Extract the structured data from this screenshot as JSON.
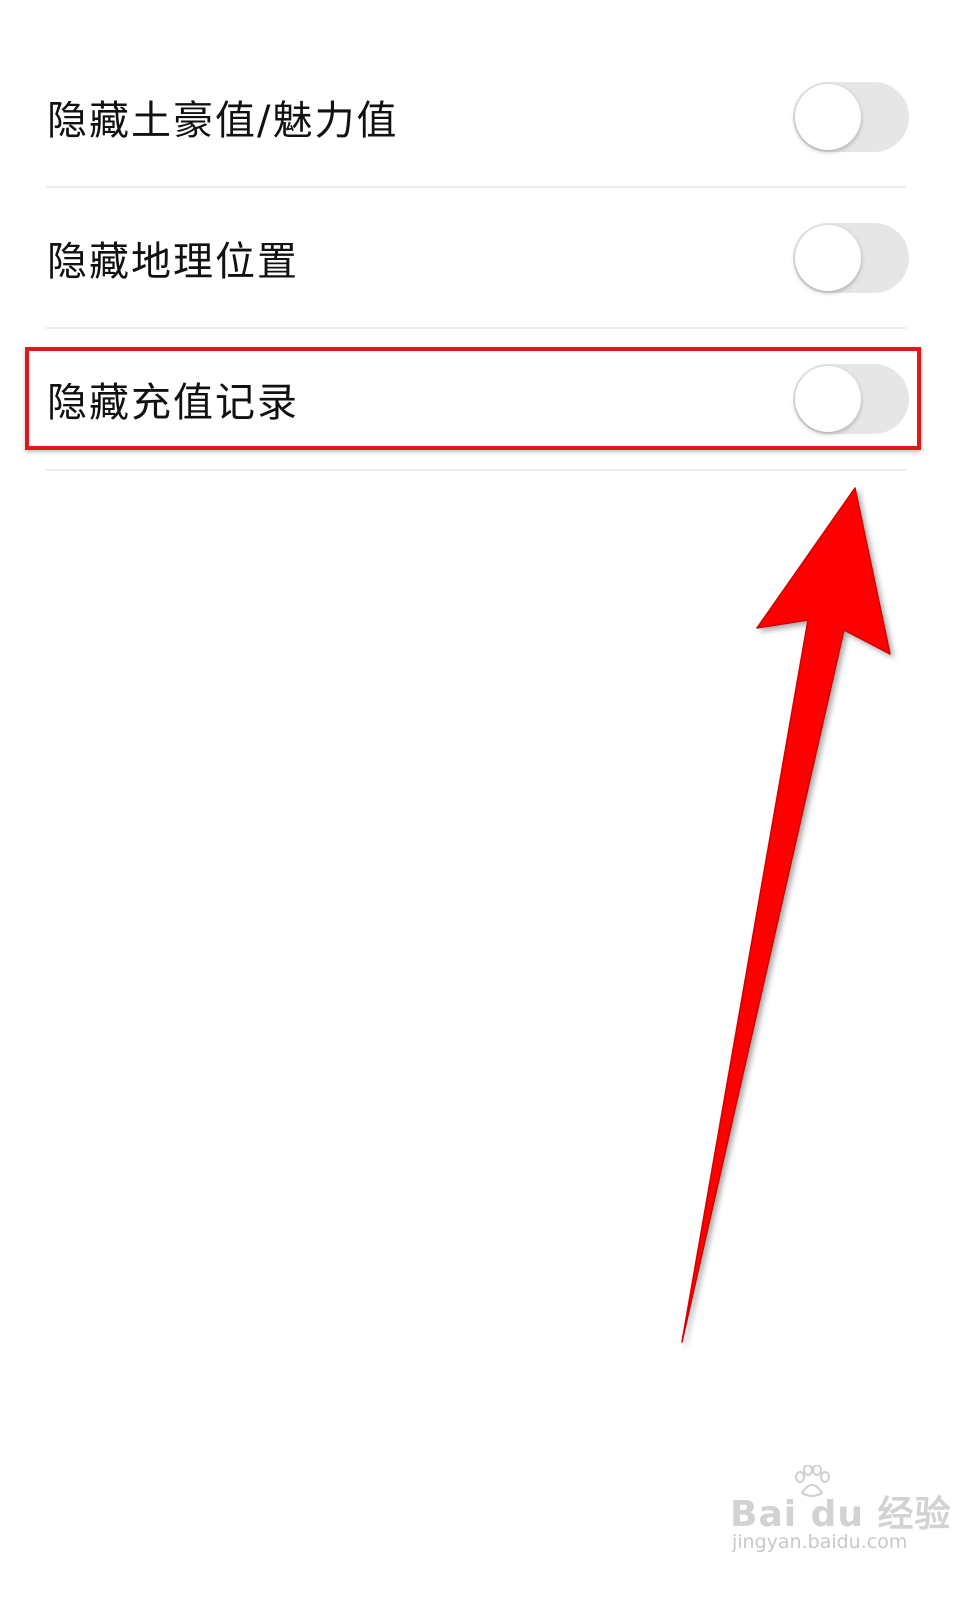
{
  "settings": [
    {
      "label": "隐藏土豪值/魅力值",
      "enabled": false
    },
    {
      "label": "隐藏地理位置",
      "enabled": false
    },
    {
      "label": "隐藏充值记录",
      "enabled": false
    }
  ],
  "highlight": {
    "target": "隐藏充值记录",
    "color": "#e0181b"
  },
  "annotation": {
    "arrow_color": "#ff0000"
  },
  "watermark": {
    "brand": "Bai du 经验",
    "url": "jingyan.baidu.com"
  }
}
